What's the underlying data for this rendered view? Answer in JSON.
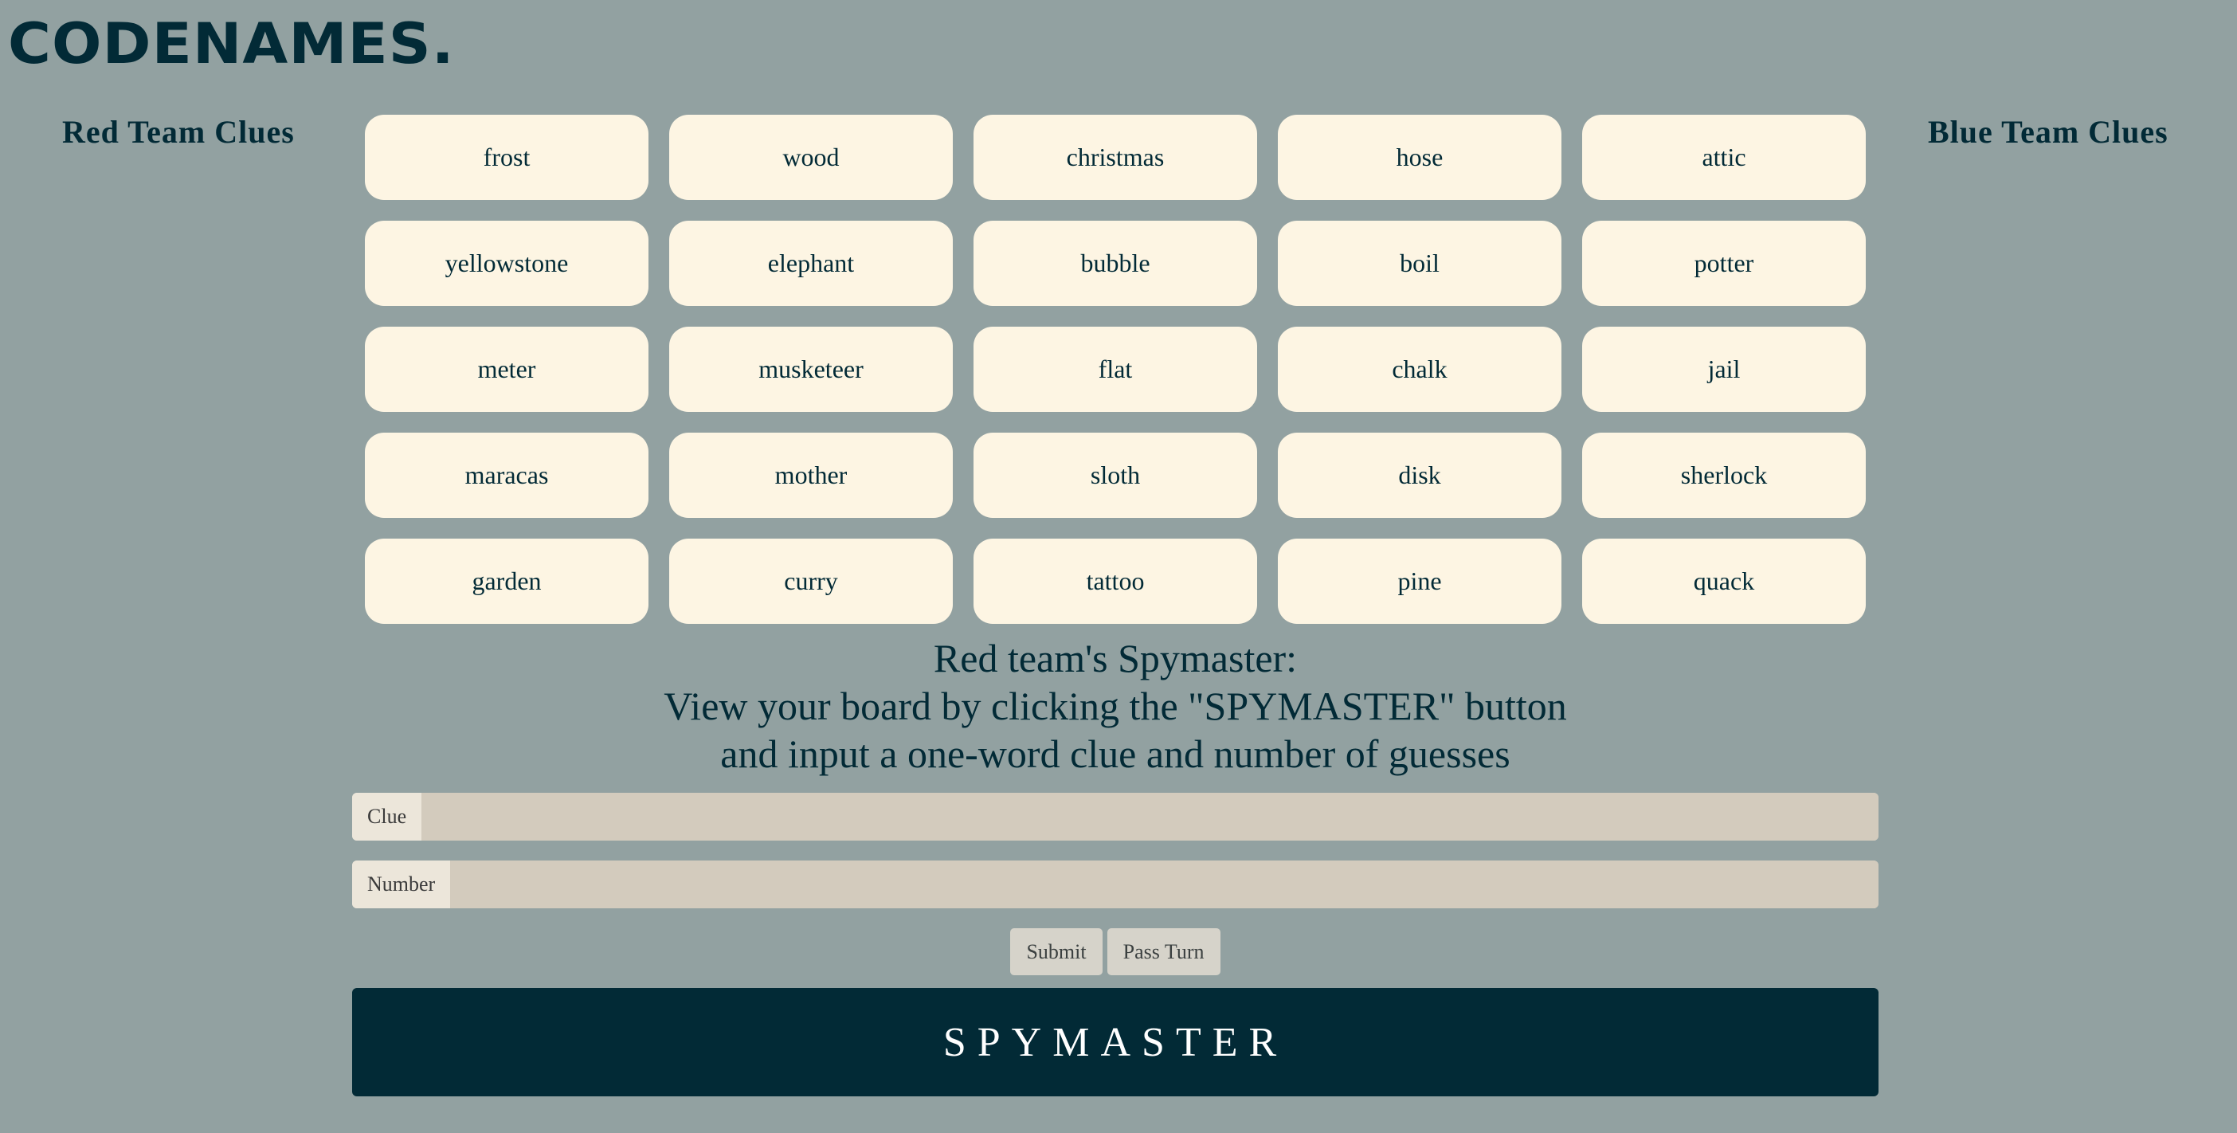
{
  "app": {
    "logo": "CODENAMES."
  },
  "colors": {
    "background": "#92a1a1",
    "card": "#fdf5e3",
    "text": "#022a36",
    "spymaster_button": "#022a36"
  },
  "clues": {
    "red_heading": "Red Team Clues",
    "blue_heading": "Blue Team Clues"
  },
  "board": {
    "words": [
      "frost",
      "wood",
      "christmas",
      "hose",
      "attic",
      "yellowstone",
      "elephant",
      "bubble",
      "boil",
      "potter",
      "meter",
      "musketeer",
      "flat",
      "chalk",
      "jail",
      "maracas",
      "mother",
      "sloth",
      "disk",
      "sherlock",
      "garden",
      "curry",
      "tattoo",
      "pine",
      "quack"
    ]
  },
  "instructions": {
    "line1": "Red team's Spymaster:",
    "line2": "View your board by clicking the \"SPYMASTER\" button",
    "line3": "and input a one-word clue and number of guesses"
  },
  "form": {
    "clue_label": "Clue",
    "clue_value": "",
    "number_label": "Number",
    "number_value": ""
  },
  "actions": {
    "submit_label": "Submit",
    "pass_label": "Pass Turn",
    "spymaster_label": "SPYMASTER"
  }
}
